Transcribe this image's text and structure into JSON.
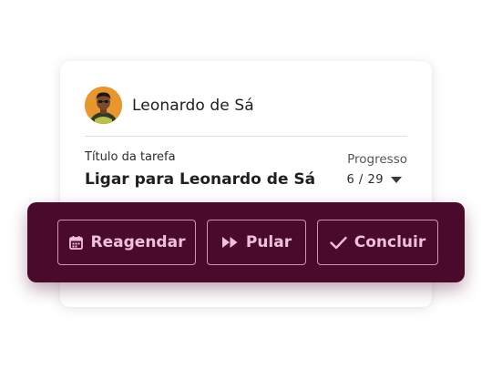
{
  "contact": {
    "name": "Leonardo de Sá",
    "avatar_icon": "person-photo"
  },
  "task": {
    "label": "Título da tarefa",
    "title": "Ligar para Leonardo de Sá"
  },
  "progress": {
    "label": "Progresso",
    "value": "6 / 29",
    "current": 6,
    "total": 29
  },
  "actions": {
    "reschedule_label": "Reagendar",
    "reschedule_icon": "calendar-icon",
    "skip_label": "Pular",
    "skip_icon": "fast-forward-icon",
    "complete_label": "Concluir",
    "complete_icon": "check-icon"
  },
  "colors": {
    "action_bar_bg": "#4a0a2c",
    "action_text": "#f0bfdc",
    "avatar_bg": "#e8972e"
  }
}
